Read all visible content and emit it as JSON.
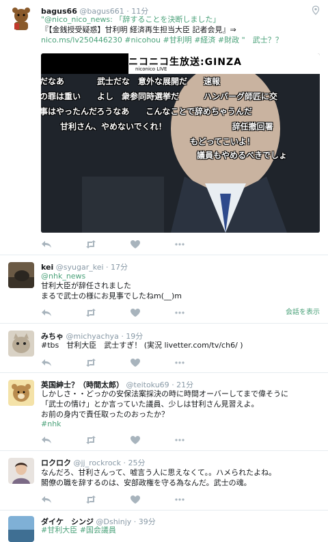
{
  "colors": {
    "link": "#4aa179",
    "meta": "#8899a6",
    "icon": "#a8b4bd",
    "divider": "#e6ecf0"
  },
  "tweets": [
    {
      "name": "bagus66",
      "handle": "@bagus661",
      "time": "· 11分",
      "lines": [
        "\"@nico_nico_news: 「辞することを決断しました」",
        "『【金銭授受疑惑】甘利明 経済再生担当大臣 記者会見』⇒",
        "nico.ms/lv250446230 #nicohou #甘利明 #経済 #財政 \"　武士？？"
      ],
      "video": {
        "logo_title": "ニコニコ生放送:GINZA",
        "logo_sub": "niconico LIVE",
        "comments": [
          "だなあ　　　　武士だな　意外な展開だ　　速報",
          "の罪は重い　　よし　衆参同時選挙だ　　　ハンバーグ師匠に交",
          "事はやったんだろうなあ　　こんなことで辞めちゃうんだ",
          "甘利さん、やめないでくれ！　　　　　　　　辞任撤回署",
          "もどってこいよ！",
          "議員もやめるべきでしょ"
        ]
      }
    },
    {
      "name": "kei",
      "handle": "@syugar_kei",
      "time": "· 17分",
      "lines": [
        "@nhk_news",
        "甘利大臣が辞任されました",
        "まるで武士の様にお見事でしたねm(__)m"
      ],
      "show_conversation": "会話を表示"
    },
    {
      "name": "みちゃ",
      "handle": "@michyachya",
      "time": "· 19分",
      "lines": [
        "#tbs　甘利大臣　武士すぎ！ (実況 livetter.com/tv/ch6/ )"
      ]
    },
    {
      "name": "英国紳士？（時間太郎）",
      "handle": "@teitoku69",
      "time": "· 21分",
      "lines": [
        "しかしさ・・どっかの安保法案採決の時に時間オーバーしてまで偉そうに",
        "「武士の情け」とか言っていた議員、少しは甘利さん見習えよ。",
        "お前の身内で責任取ったのおったか？",
        "#nhk"
      ]
    },
    {
      "name": "ロクロク",
      "handle": "@jj_rockrock",
      "time": "· 25分",
      "lines": [
        "なんだろ、甘利さんって、嘘言う人に思えなくて。。ハメられたよね。",
        "閣僚の職を辞するのは、安部政権を守る為なんだ。武士の魂。"
      ]
    },
    {
      "name": "ダイケ　シンジ",
      "handle": "@Dshinjy",
      "time": "· 39分",
      "lines": [
        "#甘利大臣 #国会議員"
      ]
    }
  ]
}
